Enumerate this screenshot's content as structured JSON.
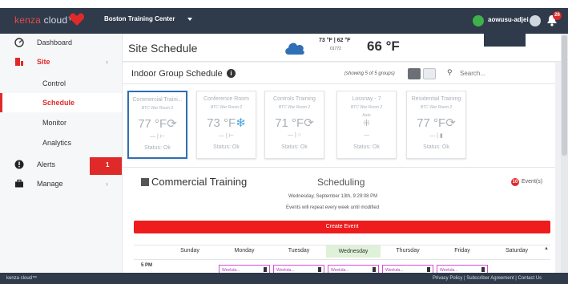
{
  "topbar": {
    "logo_brand": "kenza",
    "logo_cloud": "cloud",
    "logo_tm": "™",
    "site": "Boston Training Center",
    "user": "aowusu-adjei",
    "notification_count": "26",
    "colors": {
      "bar": "#2f3a4b",
      "accent": "#e02a2a",
      "online": "#3fb14b"
    }
  },
  "sidebar": {
    "dashboard": "Dashboard",
    "site": "Site",
    "control": "Control",
    "schedule": "Schedule",
    "monitor": "Monitor",
    "analytics": "Analytics",
    "alerts": "Alerts",
    "alerts_count": "1",
    "manage": "Manage"
  },
  "header": {
    "title": "Site Schedule",
    "weather": "73 °F | 62 °F",
    "zip": "01772",
    "current_temp": "66 °F"
  },
  "panel": {
    "title": "Indoor Group Schedule",
    "showing": "(showing 5 of 5 groups)",
    "search_placeholder": "Search..."
  },
  "groups": [
    {
      "name": "Commercial Traini...",
      "room": "BTC War Room 2",
      "temp": "77 °F",
      "mode": "⟳",
      "ctl": "— | ⊢",
      "status": "Status: Ok"
    },
    {
      "name": "Conference Room",
      "room": "BTC War Room 2",
      "temp": "73 °F",
      "mode": "❄",
      "ctl": "— | ⊢",
      "status": "Status: Ok"
    },
    {
      "name": "Controls Training",
      "room": "BTC War Room 2",
      "temp": "71 °F",
      "mode": "⟳",
      "ctl": "— | ○",
      "status": "Status: Ok"
    },
    {
      "name": "Lossnay - 7",
      "room": "BTC War Room 2",
      "auto": "Auto",
      "fan": "⁜",
      "ctl": "—",
      "status": "Status: Ok"
    },
    {
      "name": "Residential Training",
      "room": "BTC War Room 2",
      "temp": "77 °F",
      "mode": "⟳",
      "ctl": "— | ▮",
      "status": "Status: Ok"
    }
  ],
  "schedule": {
    "group": "Commercial Training",
    "title": "Scheduling",
    "events_count": "10",
    "events_label": "Event(s)",
    "datetime": "Wednesday, September 13th, 9:29:08 PM",
    "repeat": "Events will repeat every week until modified",
    "create": "Create Event",
    "days": [
      "Sunday",
      "Monday",
      "Tuesday",
      "Wednesday",
      "Thursday",
      "Friday",
      "Saturday"
    ],
    "hour": "5 PM",
    "event_label": "Weekda..."
  },
  "footer": {
    "brand": "kenza cloud™",
    "links": "Privacy Policy | Subscriber Agreement | Contact Us"
  }
}
